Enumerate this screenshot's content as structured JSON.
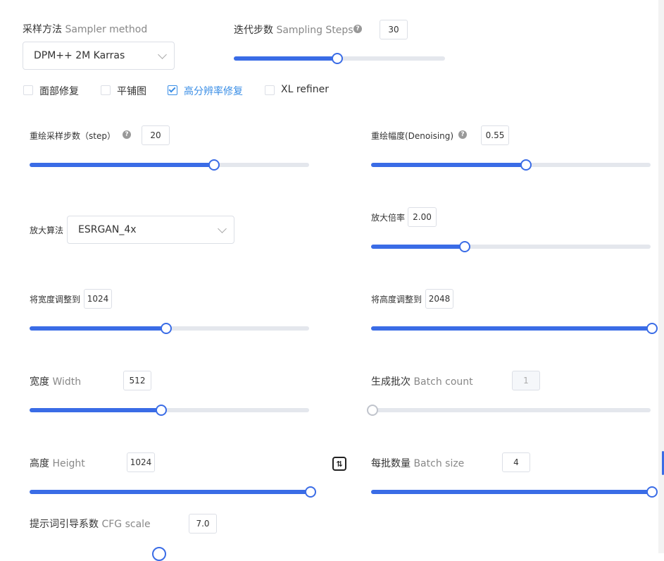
{
  "sampler": {
    "label_zh": "采样方法",
    "label_en": "Sampler method",
    "value": "DPM++ 2M Karras"
  },
  "steps": {
    "label_zh": "迭代步数",
    "label_en": "Sampling Steps",
    "value": "30",
    "fraction": 0.49
  },
  "checkboxes": [
    {
      "label": "面部修复",
      "checked": false
    },
    {
      "label": "平铺图",
      "checked": false
    },
    {
      "label": "高分辨率修复",
      "checked": true
    },
    {
      "label": "XL refiner",
      "checked": false
    }
  ],
  "hires_steps": {
    "label": "重绘采样步数（step）",
    "value": "20",
    "fraction": 0.655
  },
  "denoising": {
    "label": "重绘幅度(Denoising)",
    "value": "0.55",
    "fraction": 0.55
  },
  "upscaler": {
    "label": "放大算法",
    "value": "ESRGAN_4x"
  },
  "upscale_by": {
    "label": "放大倍率",
    "value": "2.00",
    "fraction": 0.33
  },
  "resize_width": {
    "label": "将宽度调整到",
    "value": "1024",
    "fraction": 0.485
  },
  "resize_height": {
    "label": "将高度调整到",
    "value": "2048",
    "fraction": 1.0
  },
  "width": {
    "label_zh": "宽度",
    "label_en": "Width",
    "value": "512",
    "fraction": 0.467
  },
  "batch_count": {
    "label_zh": "生成批次",
    "label_en": "Batch count",
    "value": "1",
    "fraction": 0.0
  },
  "height": {
    "label_zh": "高度",
    "label_en": "Height",
    "value": "1024",
    "fraction": 1.0
  },
  "batch_size": {
    "label_zh": "每批数量",
    "label_en": "Batch size",
    "value": "4",
    "fraction": 1.0
  },
  "cfg": {
    "label_zh": "提示词引导系数",
    "label_en": "CFG scale",
    "value": "7.0"
  },
  "swap_icon": "swap-vertical-icon",
  "colors": {
    "accent": "#3a6ce6",
    "checkbox_accent": "#3a8ee6",
    "track": "#e4e7ed"
  }
}
